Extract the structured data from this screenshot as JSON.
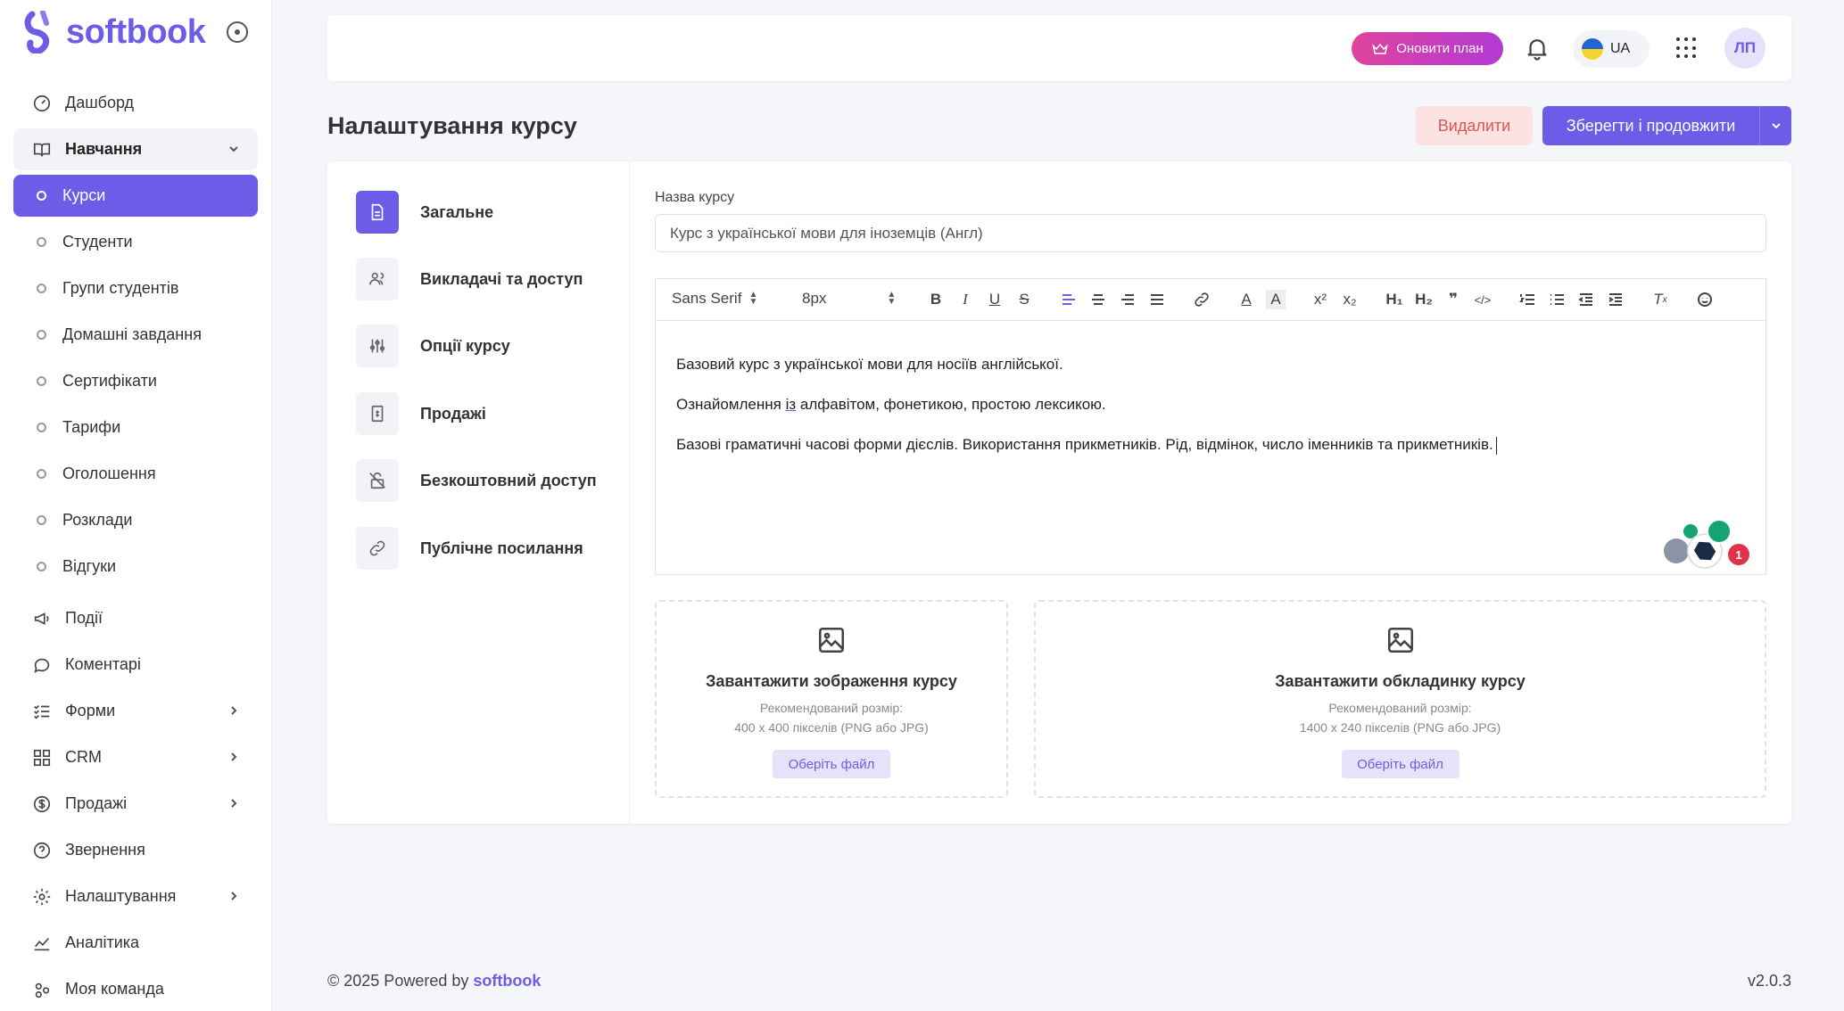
{
  "app": {
    "logo_text": "softbook"
  },
  "sidebar": {
    "items": [
      {
        "label": "Дашборд",
        "icon": "gauge-icon"
      },
      {
        "label": "Навчання",
        "icon": "book-icon"
      },
      {
        "label": "Курси"
      },
      {
        "label": "Студенти"
      },
      {
        "label": "Групи студентів"
      },
      {
        "label": "Домашні завдання"
      },
      {
        "label": "Сертифікати"
      },
      {
        "label": "Тарифи"
      },
      {
        "label": "Оголошення"
      },
      {
        "label": "Розклади"
      },
      {
        "label": "Відгуки"
      },
      {
        "label": "Події",
        "icon": "megaphone-icon"
      },
      {
        "label": "Коментарі",
        "icon": "comment-icon"
      },
      {
        "label": "Форми",
        "icon": "list-check-icon"
      },
      {
        "label": "CRM",
        "icon": "grid-icon"
      },
      {
        "label": "Продажі",
        "icon": "dollar-icon"
      },
      {
        "label": "Звернення",
        "icon": "help-icon"
      },
      {
        "label": "Налаштування",
        "icon": "gear-icon"
      },
      {
        "label": "Аналітика",
        "icon": "chart-icon"
      },
      {
        "label": "Моя команда",
        "icon": "team-icon"
      }
    ]
  },
  "topbar": {
    "upgrade_label": "Оновити план",
    "lang_code": "UA",
    "avatar_initials": "ЛП"
  },
  "page": {
    "title": "Налаштування курсу",
    "delete_label": "Видалити",
    "save_label": "Зберегти і продовжити"
  },
  "tabs": [
    {
      "label": "Загальне",
      "icon": "document-icon",
      "active": true
    },
    {
      "label": "Викладачі та доступ",
      "icon": "users-icon"
    },
    {
      "label": "Опції курсу",
      "icon": "sliders-icon"
    },
    {
      "label": "Продажі",
      "icon": "receipt-icon"
    },
    {
      "label": "Безкоштовний доступ",
      "icon": "unlock-icon"
    },
    {
      "label": "Публічне посилання",
      "icon": "link-icon"
    }
  ],
  "form": {
    "course_name_label": "Назва курсу",
    "course_name_value": "Курс з української мови для іноземців (Англ)",
    "editor": {
      "font_family": "Sans Serif",
      "font_size": "8px",
      "paragraphs": {
        "p1": "Базовий курс з української мови для носіїв англійської.",
        "p2_before": "Ознайомлення ",
        "p2_underlined": "із",
        "p2_after": " алфавітом, фонетикою, простою лексикою.",
        "p3": "Базові граматичні часові форми дієслів. Використання прикметників. Рід, відмінок, число іменників та прикметників."
      },
      "extension_badge_count": "1"
    },
    "upload_image": {
      "title": "Завантажити зображення курсу",
      "hint_line1": "Рекомендований розмір:",
      "hint_line2": "400 x 400 пікселів (PNG або JPG)",
      "button": "Оберіть файл"
    },
    "upload_cover": {
      "title": "Завантажити обкладинку курсу",
      "hint_line1": "Рекомендований розмір:",
      "hint_line2": "1400 x 240 пікселів (PNG або JPG)",
      "button": "Оберіть файл"
    }
  },
  "footer": {
    "prefix": "© 2025 Powered by",
    "brand": "softbook",
    "version": "v2.0.3"
  },
  "colors": {
    "accent": "#6c5ce7",
    "danger_bg": "#fde2e2",
    "danger_text": "#e05555"
  }
}
